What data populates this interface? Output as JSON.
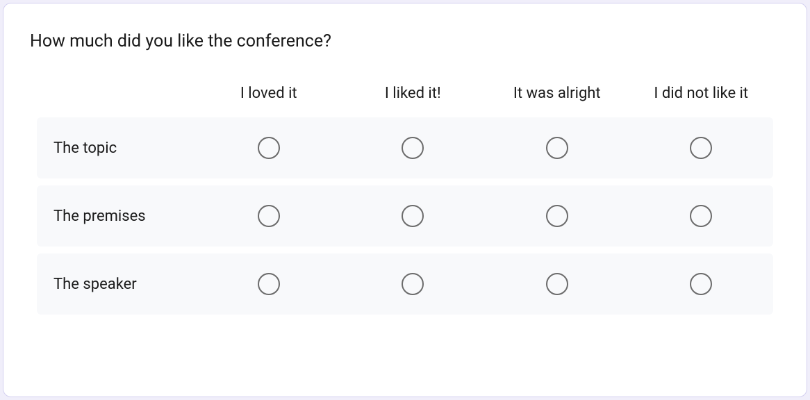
{
  "question": {
    "title": "How much did you like the conference?",
    "columns": [
      "I loved it",
      "I liked it!",
      "It was alright",
      "I did not like it"
    ],
    "rows": [
      "The topic",
      "The premises",
      "The speaker"
    ]
  }
}
